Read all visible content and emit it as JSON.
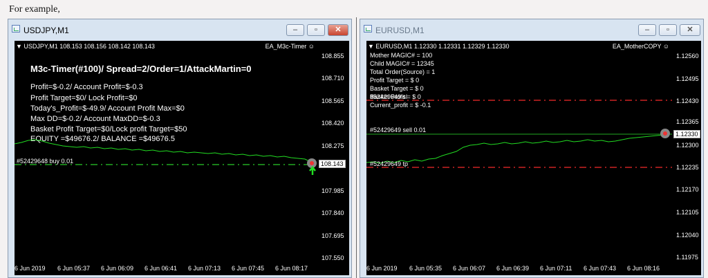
{
  "caption": "For example,",
  "left": {
    "title": "USDJPY,M1",
    "header": "USDJPY,M1  108.153 108.156 108.142 108.143",
    "ea": "EA_M3c-Timer",
    "big_line": "M3c-Timer(#100)/ Spread=2/Order=1/AttackMartin=0",
    "lines": [
      "Profit=$-0.2/ Account Profit=$-0.3",
      "Profit Target=$0/ Lock Profit=$0",
      "Today's_Profit=$-49.9/ Account Profit Max=$0",
      "Max DD=$-0.2/ Account MaxDD=$-0.3",
      "Basket Profit Target=$0/Lock profit Target=$50",
      "EQUITY =$49676.2/ BALANCE =$49676.5"
    ],
    "order_label": "#52429648 buy 0.01",
    "price_box": "108.143",
    "y_ticks": [
      "108.855",
      "108.710",
      "108.565",
      "108.420",
      "108.275",
      "108.130",
      "107.985",
      "107.840",
      "107.695",
      "107.550"
    ],
    "x_ticks": [
      "6 Jun 2019",
      "6 Jun 05:37",
      "6 Jun 06:09",
      "6 Jun 06:41",
      "6 Jun 07:13",
      "6 Jun 07:45",
      "6 Jun 08:17"
    ]
  },
  "right": {
    "title": "EURUSD,M1",
    "header": "EURUSD,M1  1.12330 1.12331 1.12329 1.12330",
    "ea": "EA_MotherCOPY",
    "lines": [
      "Mother MAGIC# = 100",
      "Child MAGIC# = 12345",
      "Total Order(Source) = 1",
      "Profit Target = $ 0",
      "Basket Target = $ 0",
      "Basket Profit = $ 0",
      "Current_profit = $ -0.1"
    ],
    "overlap_label": "#52429649 sl",
    "order_label": "#52429649 sell 0.01",
    "tp_label": "#52429649 tp",
    "price_box": "1.12330",
    "y_ticks": [
      "1.12560",
      "1.12495",
      "1.12430",
      "1.12365",
      "1.12300",
      "1.12235",
      "1.12170",
      "1.12105",
      "1.12040",
      "1.11975"
    ],
    "x_ticks": [
      "6 Jun 2019",
      "6 Jun 05:35",
      "6 Jun 06:07",
      "6 Jun 06:39",
      "6 Jun 07:11",
      "6 Jun 07:43",
      "6 Jun 08:16"
    ]
  },
  "colors": {
    "price_line": "#22dd22",
    "sl_tp_line": "#cc2222",
    "order_line": "#22aa22"
  }
}
